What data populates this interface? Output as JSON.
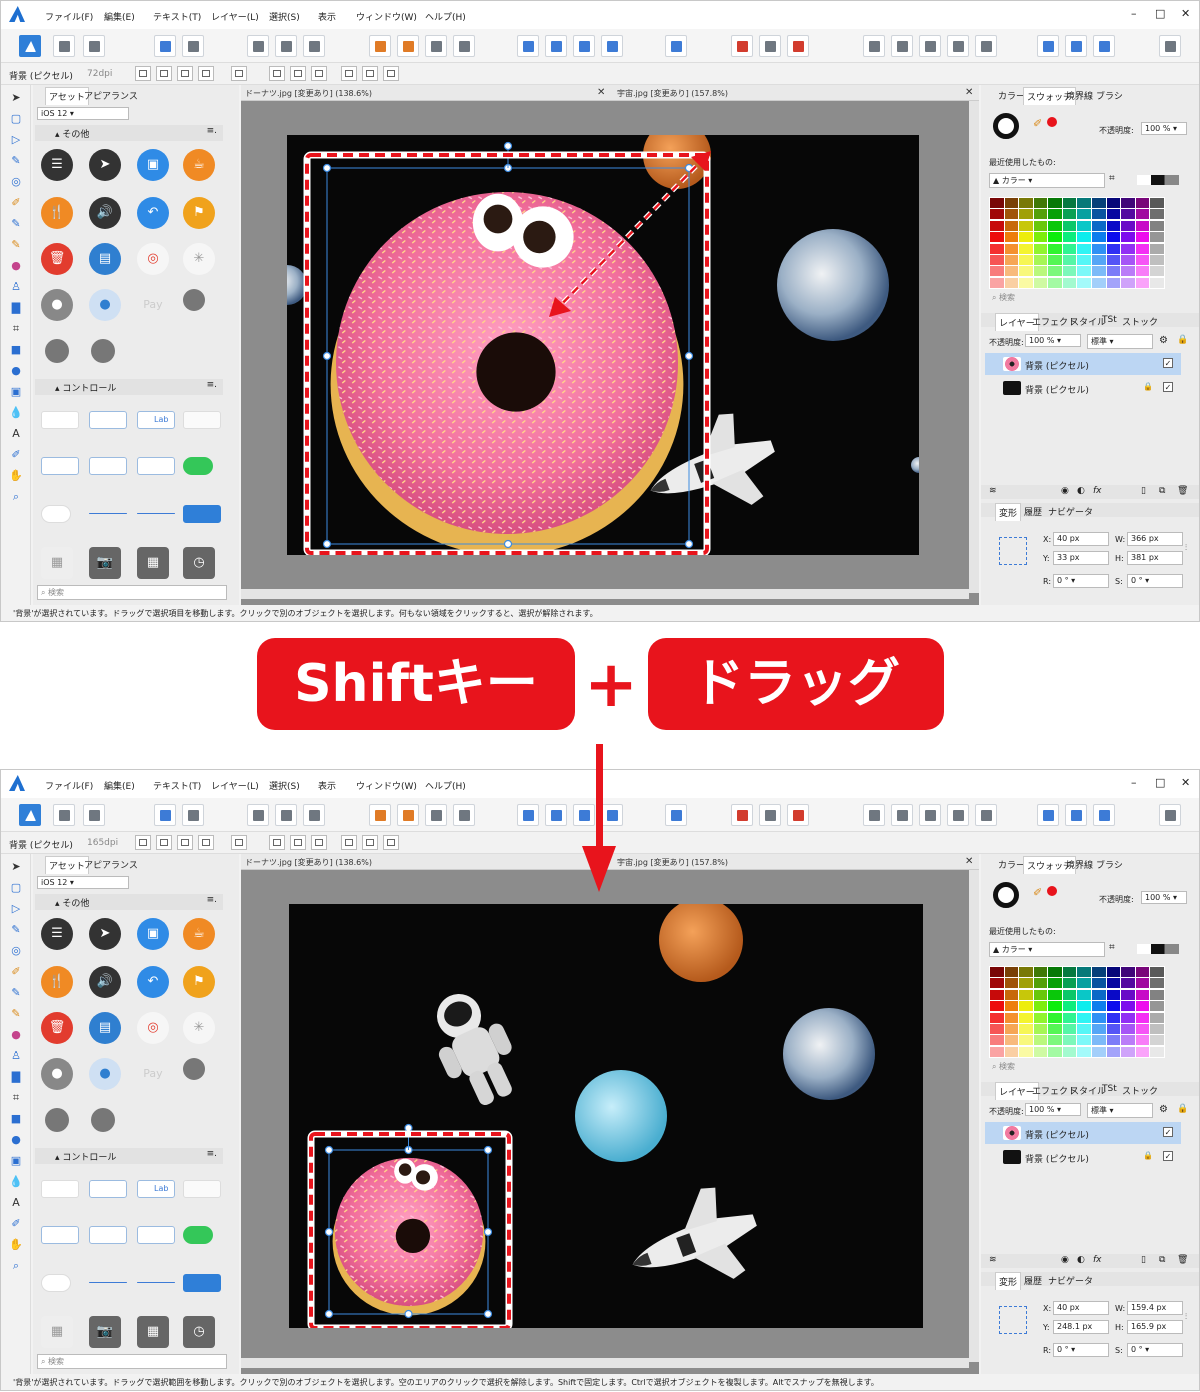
{
  "menu": [
    "ファイル(F)",
    "編集(E)",
    "テキスト(T)",
    "レイヤー(L)",
    "選択(S)",
    "表示",
    "ウィンドウ(W)",
    "ヘルプ(H)"
  ],
  "window_controls": {
    "minimize": "–",
    "maximize": "□",
    "close": "✕"
  },
  "context": {
    "label": "背景 (ピクセル)",
    "dpi_top": "72dpi",
    "dpi_bottom": "165dpi"
  },
  "left_panel": {
    "tabs": [
      "アセット",
      "アピアランス"
    ],
    "category": "iOS 12",
    "section_other": "その他",
    "section_controls": "コントロール",
    "menu_glyph": "≡.",
    "search_placeholder": "検索",
    "control_label": "Lab"
  },
  "documents": {
    "top": [
      {
        "name": "ドーナツ.jpg [変更あり] (138.6%)"
      },
      {
        "name": "宇宙.jpg [変更あり] (157.8%)"
      }
    ],
    "bottom": [
      {
        "name": "ドーナツ.jpg [変更あり] (138.6%)"
      },
      {
        "name": "宇宙.jpg [変更あり] (157.8%)"
      }
    ]
  },
  "right_panel": {
    "tabs_top": [
      "カラー",
      "スウォッチ",
      "境界線",
      "ブラシ"
    ],
    "opacity_label": "不透明度:",
    "opacity_value": "100 %",
    "recent_label": "最近使用したもの:",
    "palette_name": "カラー",
    "search_placeholder": "検索",
    "tabs_layers": [
      "レイヤー",
      "エフェクト",
      "スタイル",
      "TSt",
      "ストック"
    ],
    "blend_mode": "標準",
    "layers": [
      {
        "name": "背景 (ピクセル)",
        "selected": true
      },
      {
        "name": "背景 (ピクセル)",
        "selected": false
      }
    ],
    "tabs_transform": [
      "変形",
      "履歴",
      "ナビゲータ"
    ],
    "fx_label": "fx"
  },
  "transform_top": {
    "x": "40 px",
    "y": "33 px",
    "w": "366 px",
    "h": "381 px",
    "r": "0 °",
    "s": "0 °"
  },
  "transform_bottom": {
    "x": "40 px",
    "y": "248.1 px",
    "w": "159.4 px",
    "h": "165.9 px",
    "r": "0 °",
    "s": "0 °"
  },
  "transform_labels": {
    "x": "X:",
    "y": "Y:",
    "w": "W:",
    "h": "H:",
    "r": "R:",
    "s": "S:"
  },
  "status": {
    "top": "'背景'が選択されています。ドラッグで選択項目を移動します。クリックで別のオブジェクトを選択します。何もない領域をクリックすると、選択が解除されます。",
    "bottom": "'背景'が選択されています。ドラッグで選択範囲を移動します。クリックで別のオブジェクトを選択します。空のエリアのクリックで選択を解除します。Shiftで固定します。Ctrlで選択オブジェクトを複製します。Altでスナップを無視します。"
  },
  "banner": {
    "left": "Shiftキー",
    "plus": "+",
    "right": "ドラッグ"
  },
  "colors": {
    "accent": "#e8141c",
    "selection_blue": "#3d8be0",
    "brand": "#1e6fd0"
  }
}
